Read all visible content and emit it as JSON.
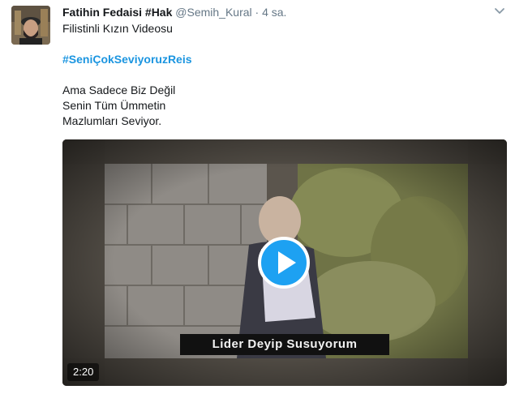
{
  "tweet": {
    "author_name": "Fatihin Fedaisi #Hak",
    "handle": "@Semih_Kural",
    "separator": "·",
    "time": "4 sa.",
    "text_line1": "Filistinli Kızın Videosu",
    "hashtag": "#SeniÇokSeviyoruzReis",
    "text_line2": "Ama Sadece Biz Değil",
    "text_line3": "Senin Tüm Ümmetin",
    "text_line4": "Mazlumları Seviyor."
  },
  "video": {
    "subtitle": "Lider Deyip Susuyorum",
    "duration": "2:20"
  },
  "colors": {
    "link": "#1b95e0",
    "muted": "#657786",
    "play_button": "#1da1f2"
  },
  "icons": {
    "menu": "chevron-down-icon",
    "play": "play-icon"
  }
}
